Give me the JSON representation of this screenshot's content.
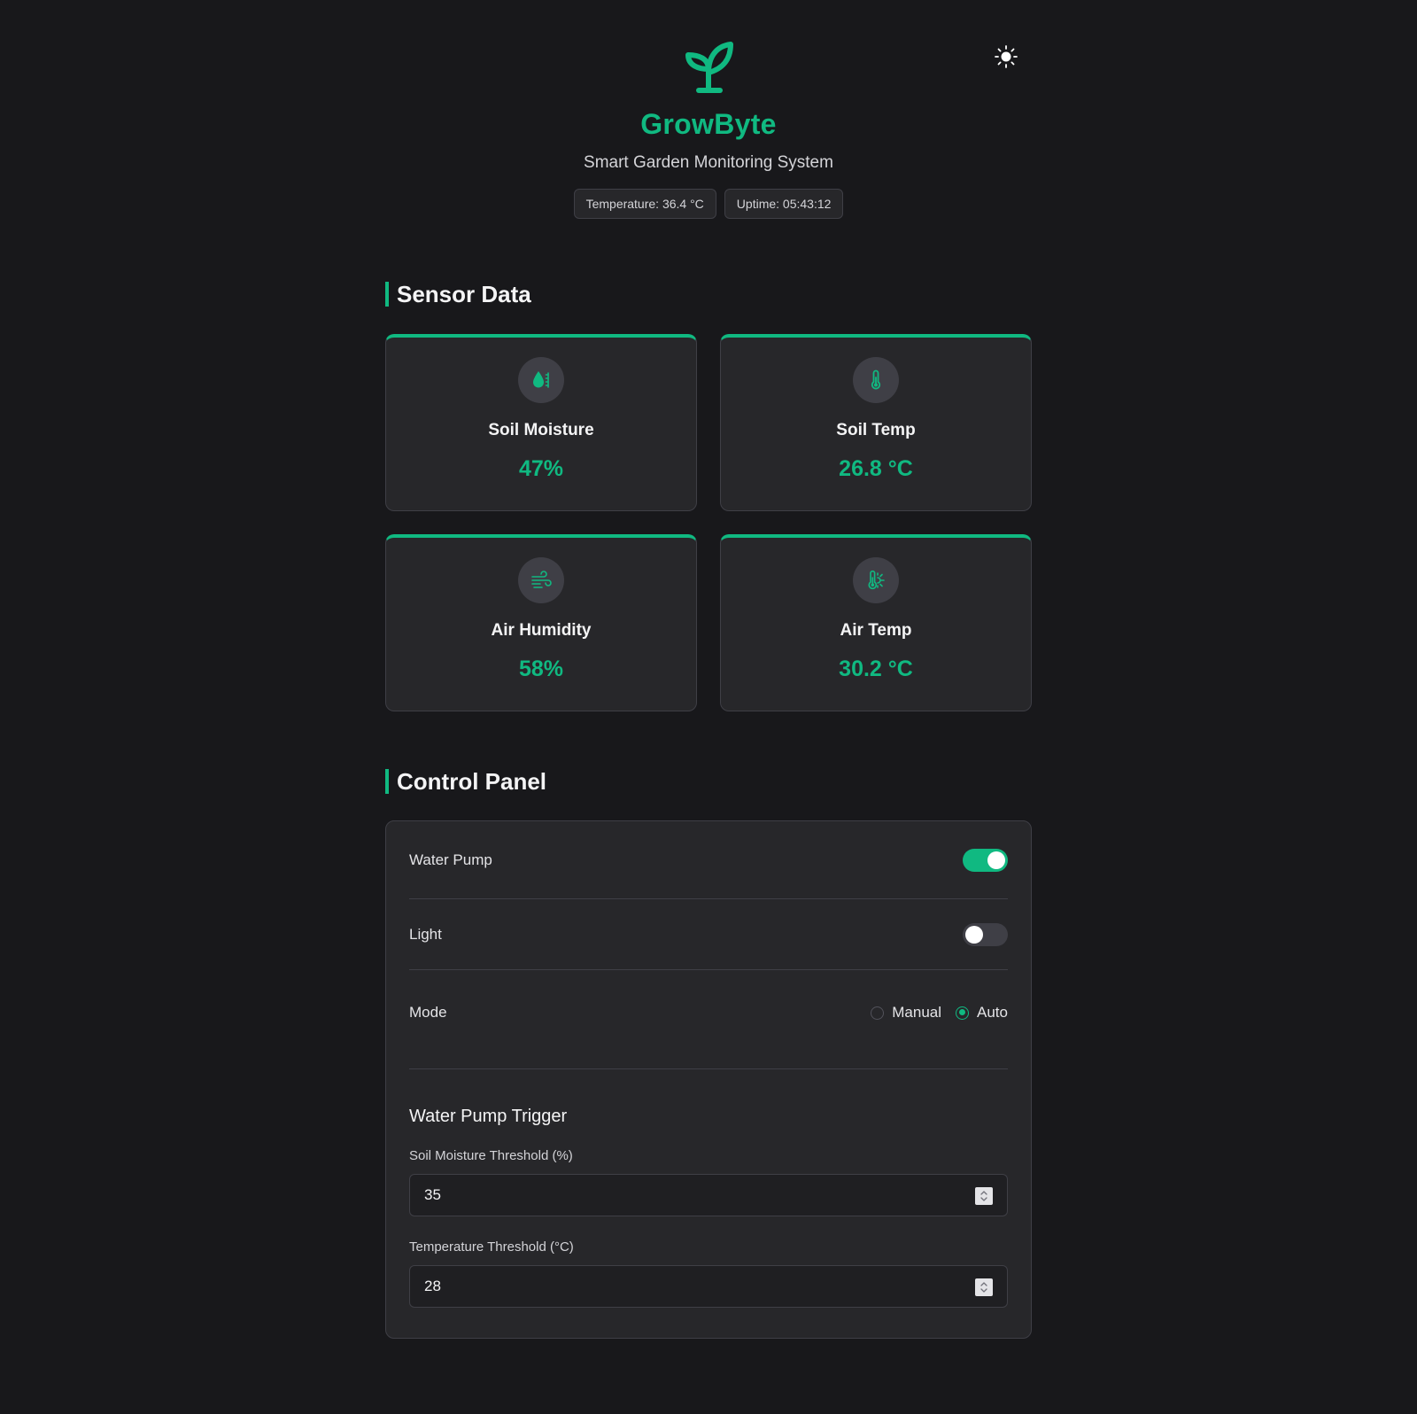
{
  "header": {
    "logo_icon": "sprout-icon",
    "title": "GrowByte",
    "subtitle": "Smart Garden Monitoring System",
    "badges": {
      "temperature": "Temperature: 36.4 °C",
      "uptime": "Uptime: 05:43:12"
    },
    "theme_toggle_icon": "sun-icon"
  },
  "sensor_section": {
    "title": "Sensor Data",
    "cards": [
      {
        "icon": "droplet-icon",
        "label": "Soil Moisture",
        "value": "47%"
      },
      {
        "icon": "thermometer-icon",
        "label": "Soil Temp",
        "value": "26.8 °C"
      },
      {
        "icon": "wind-icon",
        "label": "Air Humidity",
        "value": "58%"
      },
      {
        "icon": "thermometer-sun-icon",
        "label": "Air Temp",
        "value": "30.2 °C"
      }
    ]
  },
  "control_section": {
    "title": "Control Panel",
    "water_pump": {
      "label": "Water Pump",
      "on": true
    },
    "light": {
      "label": "Light",
      "on": false
    },
    "mode": {
      "label": "Mode",
      "options": [
        "Manual",
        "Auto"
      ],
      "selected": "Auto"
    },
    "trigger": {
      "title": "Water Pump Trigger",
      "soil_threshold": {
        "label": "Soil Moisture Threshold (%)",
        "value": "35"
      },
      "temp_threshold": {
        "label": "Temperature Threshold (°C)",
        "value": "28"
      }
    }
  },
  "colors": {
    "accent": "#10b981",
    "background": "#18181b",
    "card": "#27272a",
    "border": "#3f3f46"
  }
}
